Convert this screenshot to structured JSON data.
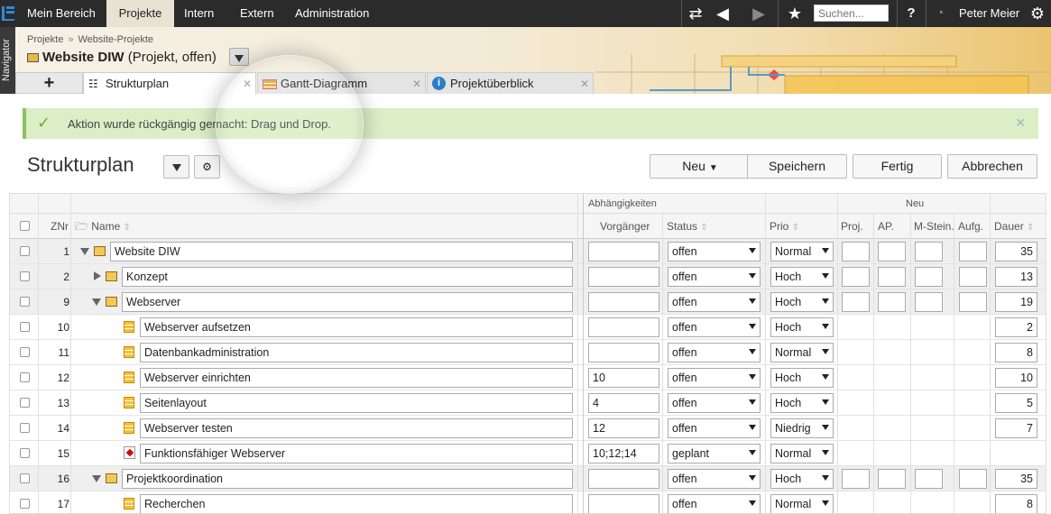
{
  "topnav": {
    "items": [
      "Mein Bereich",
      "Projekte",
      "Intern",
      "Extern",
      "Administration"
    ],
    "active_index": 1,
    "search_placeholder": "Suchen...",
    "help": "?",
    "user": "Peter Meier"
  },
  "navigator_label": "Navigator",
  "breadcrumb": [
    "Projekte",
    "Website-Projekte"
  ],
  "breadcrumb_sep": "»",
  "project": {
    "name": "Website DIW",
    "meta": "(Projekt, offen)"
  },
  "tabs": [
    {
      "label": "Strukturplan"
    },
    {
      "label": "Gantt-Diagramm"
    },
    {
      "label": "Projektüberblick"
    }
  ],
  "notification": "Aktion wurde rückgängig gemacht: Drag und Drop.",
  "page_title": "Strukturplan",
  "buttons": {
    "neu": "Neu",
    "speichern": "Speichern",
    "fertig": "Fertig",
    "abbrechen": "Abbrechen"
  },
  "table": {
    "group_headers": {
      "abhaengigkeiten": "Abhängigkeiten",
      "neu": "Neu"
    },
    "columns": {
      "znr": "ZNr",
      "name": "Name",
      "vorgaenger": "Vorgänger",
      "status": "Status",
      "prio": "Prio",
      "proj": "Proj.",
      "ap": "AP.",
      "msteine": "M-Stein.",
      "aufg": "Aufg.",
      "dauer": "Dauer"
    },
    "rows": [
      {
        "znr": "1",
        "name": "Website DIW",
        "vorg": "",
        "status": "offen",
        "prio": "Normal",
        "dauer": "35"
      },
      {
        "znr": "2",
        "name": "Konzept",
        "vorg": "",
        "status": "offen",
        "prio": "Hoch",
        "dauer": "13"
      },
      {
        "znr": "9",
        "name": "Webserver",
        "vorg": "",
        "status": "offen",
        "prio": "Hoch",
        "dauer": "19"
      },
      {
        "znr": "10",
        "name": "Webserver aufsetzen",
        "vorg": "",
        "status": "offen",
        "prio": "Hoch",
        "dauer": "2"
      },
      {
        "znr": "11",
        "name": "Datenbankadministration",
        "vorg": "",
        "status": "offen",
        "prio": "Normal",
        "dauer": "8"
      },
      {
        "znr": "12",
        "name": "Webserver einrichten",
        "vorg": "10",
        "status": "offen",
        "prio": "Hoch",
        "dauer": "10"
      },
      {
        "znr": "13",
        "name": "Seitenlayout",
        "vorg": "4",
        "status": "offen",
        "prio": "Hoch",
        "dauer": "5"
      },
      {
        "znr": "14",
        "name": "Webserver testen",
        "vorg": "12",
        "status": "offen",
        "prio": "Niedrig",
        "dauer": "7"
      },
      {
        "znr": "15",
        "name": "Funktionsfähiger Webserver",
        "vorg": "10;12;14",
        "status": "geplant",
        "prio": "Normal",
        "dauer": ""
      },
      {
        "znr": "16",
        "name": "Projektkoordination",
        "vorg": "",
        "status": "offen",
        "prio": "Hoch",
        "dauer": "35"
      },
      {
        "znr": "17",
        "name": "Recherchen",
        "vorg": "",
        "status": "offen",
        "prio": "Normal",
        "dauer": "8"
      }
    ]
  },
  "colors": {
    "topbar": "#2b2b2b",
    "notify_bg": "#dbeec6",
    "accent": "#f2c957"
  }
}
